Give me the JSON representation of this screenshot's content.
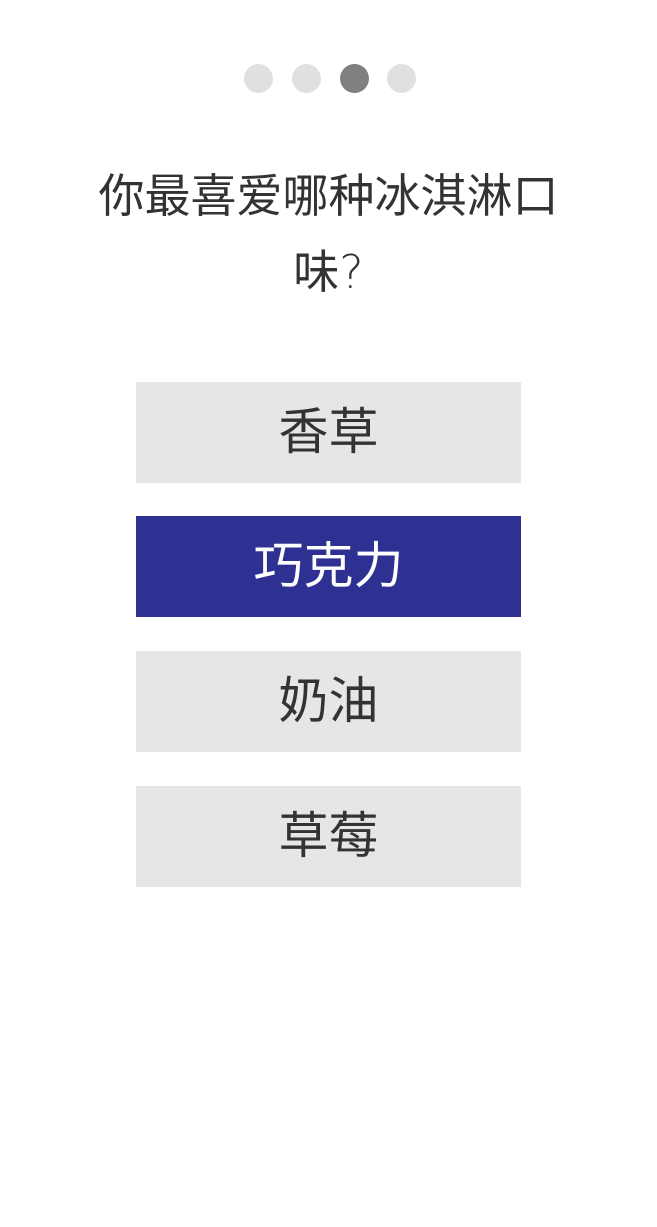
{
  "pager": {
    "total": 4,
    "current_index": 2
  },
  "question": {
    "text": "你最喜爱哪种冰淇淋口味?"
  },
  "options": [
    {
      "label": "香草",
      "selected": false
    },
    {
      "label": "巧克力",
      "selected": true
    },
    {
      "label": "奶油",
      "selected": false
    },
    {
      "label": "草莓",
      "selected": false
    }
  ],
  "colors": {
    "selected_bg": "#2e3192",
    "option_bg": "#e6e6e6",
    "dot_inactive": "#e0e0e0",
    "dot_active": "#808080",
    "text": "#333333"
  }
}
